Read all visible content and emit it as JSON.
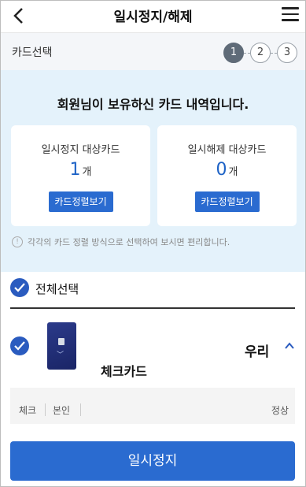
{
  "header": {
    "title": "일시정지/해제",
    "back_icon": "back-chevron-icon",
    "menu_icon": "hamburger-menu-icon"
  },
  "step_bar": {
    "label": "카드선택",
    "steps": [
      "1",
      "2",
      "3"
    ],
    "active_step": "1"
  },
  "summary": {
    "title": "회원님이 보유하신 카드 내역입니다.",
    "pause": {
      "label": "일시정지 대상카드",
      "count": "1",
      "unit": "개",
      "button": "카드정렬보기"
    },
    "release": {
      "label": "일시해제 대상카드",
      "count": "0",
      "unit": "개",
      "button": "카드정렬보기"
    },
    "notice": "각각의 카드 정렬 방식으로 선택하여 보시면 편리합니다."
  },
  "select_all": {
    "label": "전체선택",
    "checked": true
  },
  "cards": [
    {
      "name": "체크카드",
      "bank": "우리",
      "checked": true,
      "tags": [
        "체크",
        "본인"
      ],
      "status": "정상"
    }
  ],
  "action": {
    "label": "일시정지"
  },
  "colors": {
    "accent": "#2a6bd0",
    "check": "#2a5bbf",
    "summary_bg": "#e4f2fb",
    "step_active": "#5f6b78"
  }
}
